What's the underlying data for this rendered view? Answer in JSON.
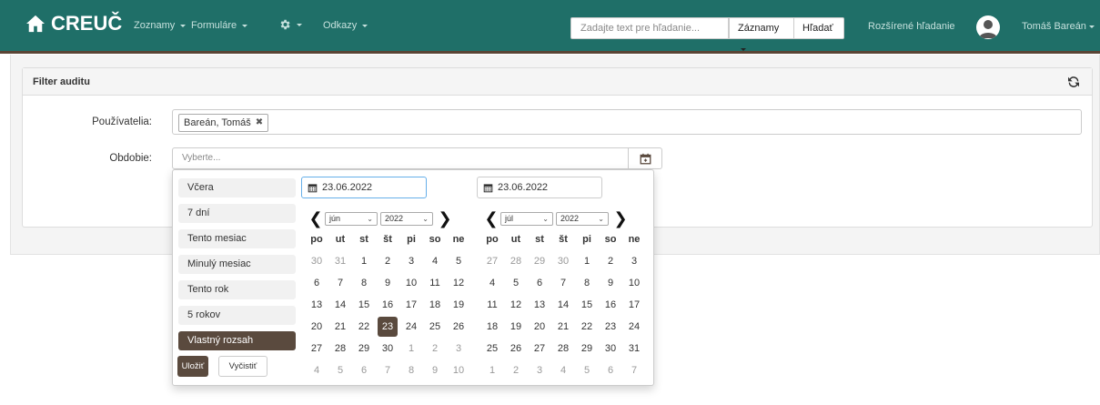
{
  "navbar": {
    "brand": "CREUČ",
    "links": [
      "Zoznamy",
      "Formuláre",
      "Odkazy"
    ],
    "search_placeholder": "Zadajte text pre hľadanie...",
    "search_scope": "Záznamy",
    "search_button": "Hľadať",
    "advanced_search": "Rozšírené hľadanie",
    "user_name": "Tomáš Bareán"
  },
  "panel": {
    "title": "Filter auditu",
    "users_label": "Používatelia:",
    "user_tag": "Bareán, Tomáš",
    "period_label": "Obdobie:",
    "period_placeholder": "Vyberte..."
  },
  "picker": {
    "ranges": [
      "Včera",
      "7 dní",
      "Tento mesiac",
      "Minulý mesiac",
      "Tento rok",
      "5 rokov",
      "Vlastný rozsah"
    ],
    "active_range": "Vlastný rozsah",
    "save_label": "Uložiť",
    "clear_label": "Vyčistiť",
    "weekday_headers": [
      "po",
      "ut",
      "st",
      "št",
      "pi",
      "so",
      "ne"
    ],
    "left": {
      "date": "23.06.2022",
      "month": "jún",
      "year": "2022",
      "days": [
        [
          "30",
          "31",
          "1",
          "2",
          "3",
          "4",
          "5"
        ],
        [
          "6",
          "7",
          "8",
          "9",
          "10",
          "11",
          "12"
        ],
        [
          "13",
          "14",
          "15",
          "16",
          "17",
          "18",
          "19"
        ],
        [
          "20",
          "21",
          "22",
          "23",
          "24",
          "25",
          "26"
        ],
        [
          "27",
          "28",
          "29",
          "30",
          "1",
          "2",
          "3"
        ],
        [
          "4",
          "5",
          "6",
          "7",
          "8",
          "9",
          "10"
        ]
      ],
      "selected_day": "23"
    },
    "right": {
      "date": "23.06.2022",
      "month": "júl",
      "year": "2022",
      "days": [
        [
          "27",
          "28",
          "29",
          "30",
          "1",
          "2",
          "3"
        ],
        [
          "4",
          "5",
          "6",
          "7",
          "8",
          "9",
          "10"
        ],
        [
          "11",
          "12",
          "13",
          "14",
          "15",
          "16",
          "17"
        ],
        [
          "18",
          "19",
          "20",
          "21",
          "22",
          "23",
          "24"
        ],
        [
          "25",
          "26",
          "27",
          "28",
          "29",
          "30",
          "31"
        ],
        [
          "1",
          "2",
          "3",
          "4",
          "5",
          "6",
          "7"
        ]
      ]
    }
  },
  "colors": {
    "navbar": "#1f6f68",
    "accent": "#5a4a3e"
  }
}
